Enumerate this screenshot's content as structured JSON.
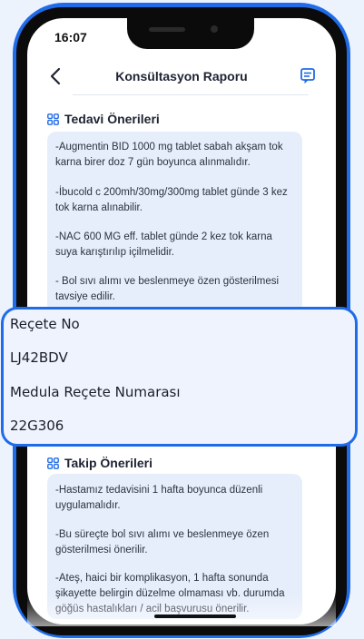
{
  "status_bar": {
    "time": "16:07"
  },
  "header": {
    "title": "Konsültasyon Raporu"
  },
  "treatment": {
    "title": "Tedavi Önerileri",
    "items": [
      "-Augmentin BID 1000 mg tablet sabah akşam tok karna birer doz 7 gün boyunca alınmalıdır.",
      "-İbucold c 200mh/30mg/300mg tablet günde 3 kez tok karna alınabilir.",
      "-NAC 600 MG eff. tablet günde 2 kez tok karna suya karıştırılıp içilmelidir.",
      "- Bol sıvı alımı ve beslenmeye özen gösterilmesi tavsiye edilir."
    ]
  },
  "prescription_popup": {
    "recete_no_label": "Reçete No",
    "recete_no_value": "LJ42BDV",
    "medula_label": "Medula Reçete Numarası",
    "medula_value": "22G306"
  },
  "followup": {
    "title": "Takip Önerileri",
    "items": [
      "-Hastamız tedavisini 1 hafta boyunca düzenli uygulamalıdır.",
      "-Bu süreçte bol sıvı alımı ve beslenmeye özen gösterilmesi önerilir.",
      "-Ateş, haici bir komplikasyon, 1 hafta sonunda şikayette belirgin düzelme olmaması vb. durumda göğüs hastalıkları / acil başvurusu önerilir."
    ]
  },
  "colors": {
    "accent": "#1f6be8",
    "card": "#e6eefb",
    "background": "#edf3fd"
  }
}
